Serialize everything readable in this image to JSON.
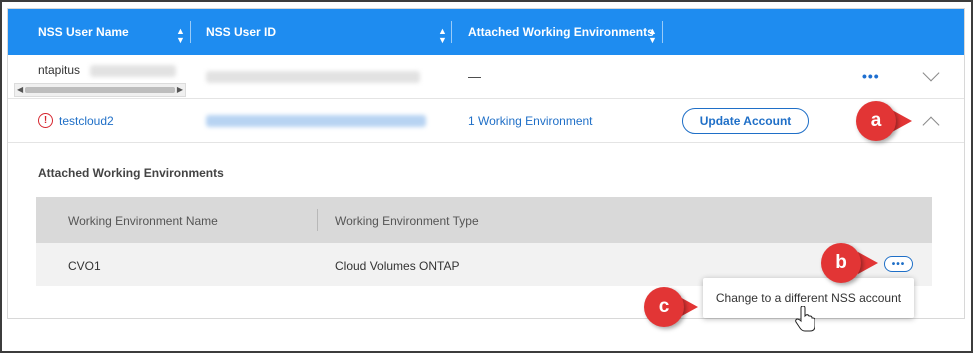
{
  "header": {
    "col_user_name": "NSS User Name",
    "col_user_id": "NSS User ID",
    "col_attached": "Attached Working Environments"
  },
  "rows": [
    {
      "user_name": "ntapitus",
      "attached": "—",
      "actions_label": "•••"
    },
    {
      "user_name": "testcloud2",
      "warning_glyph": "!",
      "attached": "1 Working Environment",
      "update_button": "Update Account"
    }
  ],
  "expanded": {
    "title": "Attached Working Environments",
    "col_name": "Working Environment Name",
    "col_type": "Working Environment Type",
    "items": [
      {
        "name": "CVO1",
        "type": "Cloud Volumes ONTAP",
        "actions_label": "•••"
      }
    ],
    "menu_item": "Change to a different NSS account"
  },
  "callouts": {
    "a": "a",
    "b": "b",
    "c": "c"
  },
  "colors": {
    "header_bg": "#1e8cf0",
    "accent": "#1f6fc7",
    "warning": "#d6262f",
    "callout": "#e23535"
  },
  "icons": [
    "sort-icon",
    "warning-circle-icon",
    "chevron-down-icon",
    "chevron-up-icon",
    "more-dots-icon",
    "hand-cursor-icon"
  ]
}
